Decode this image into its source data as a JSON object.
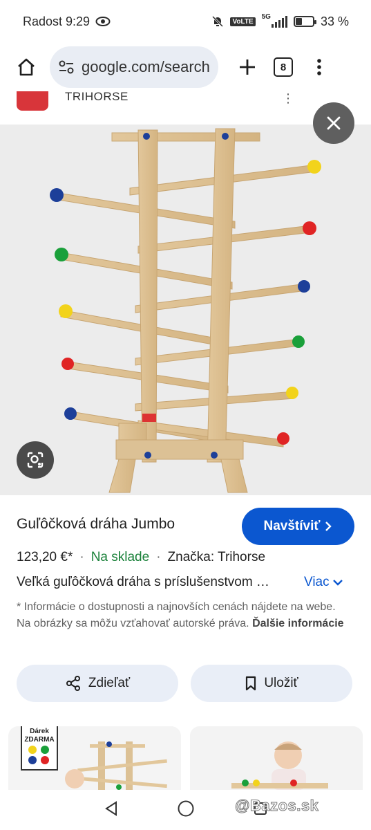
{
  "status_bar": {
    "carrier_time": "Radost 9:29",
    "volte": "VoLTE",
    "network": "5G",
    "battery_text": "33 %",
    "battery_level": 0.33
  },
  "browser": {
    "url": "google.com/search",
    "tab_count": "8"
  },
  "background_page": {
    "store_name": "TRIHORSE"
  },
  "product": {
    "title": "Guľôčková dráha Jumbo",
    "visit_label": "Navštíviť",
    "price": "123,20 €*",
    "availability": "Na sklade",
    "brand": "Značka: Trihorse",
    "description": "Veľká guľôčková dráha s príslušenstvom …",
    "more_label": "Viac",
    "disclaimer": "* Informácie o dostupnosti a najnovších cenách nájdete na webe. Na obrázky sa môžu vzťahovať autorské práva.",
    "disclaimer_link": "Ďalšie informácie",
    "share_label": "Zdieľať",
    "save_label": "Uložiť"
  },
  "related": {
    "gift_tag": "Dárek ZDARMA"
  },
  "watermark": "@Bazos.sk",
  "colors": {
    "accent": "#0b57d0",
    "in_stock": "#188038",
    "chip_bg": "#e9eef7",
    "url_bg": "#e9edf4"
  },
  "icons": [
    "home-icon",
    "site-settings-icon",
    "plus-icon",
    "tabs-icon",
    "more-vert-icon",
    "close-icon",
    "lens-icon",
    "chevron-right-icon",
    "chevron-down-icon",
    "share-icon",
    "bookmark-icon",
    "back-icon",
    "home-circle-icon",
    "recents-icon"
  ]
}
